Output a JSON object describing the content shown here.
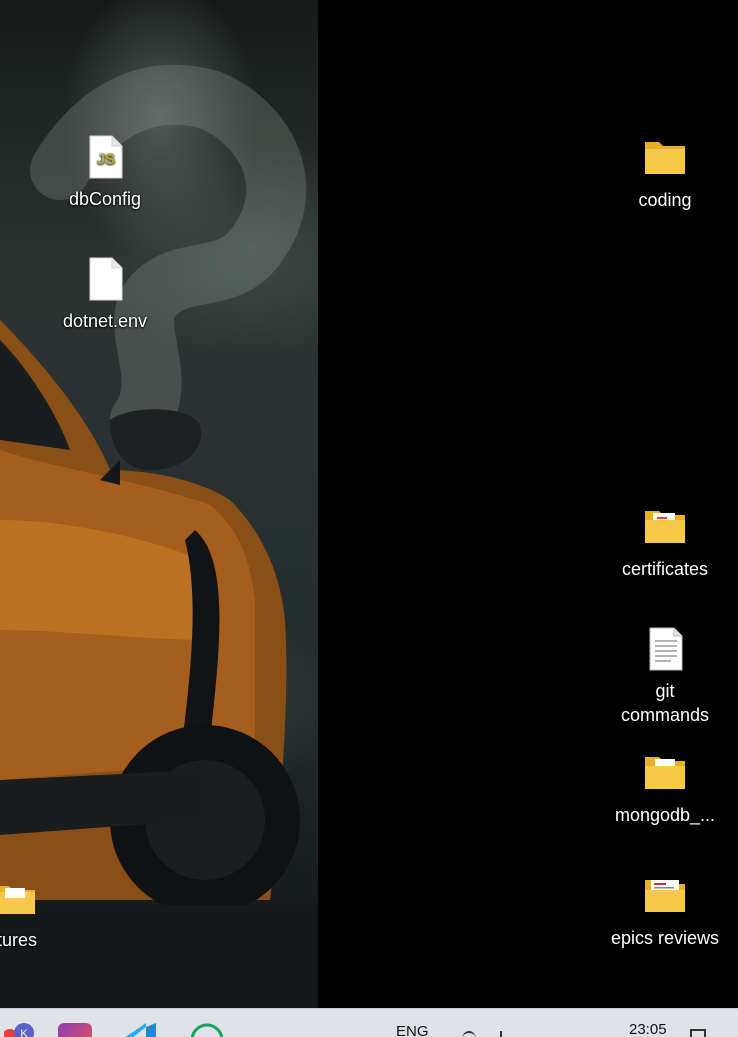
{
  "desktop": {
    "left_icons": [
      {
        "label": "dbConfig",
        "icon": "js-file-icon"
      },
      {
        "label": "dotnet.env",
        "icon": "blank-file-icon"
      },
      {
        "label": "tures",
        "icon": "folder-icon"
      }
    ],
    "right_icons": [
      {
        "label": "coding",
        "icon": "folder-icon"
      },
      {
        "label": "certificates",
        "icon": "folder-icon"
      },
      {
        "label_line1": "git",
        "label_line2": "commands",
        "icon": "text-file-icon"
      },
      {
        "label": "mongodb_...",
        "icon": "folder-icon"
      },
      {
        "label": "epics reviews",
        "icon": "folder-icon"
      }
    ]
  },
  "taskbar": {
    "language": "ENG",
    "time": "23:05",
    "apps": [
      "teams-icon",
      "instagram-icon",
      "vscode-icon",
      "whatsapp-icon"
    ]
  },
  "colors": {
    "folder": "#f7c94b",
    "folder_dark": "#e9ae2c",
    "taskbar": "#dfe3e8"
  }
}
